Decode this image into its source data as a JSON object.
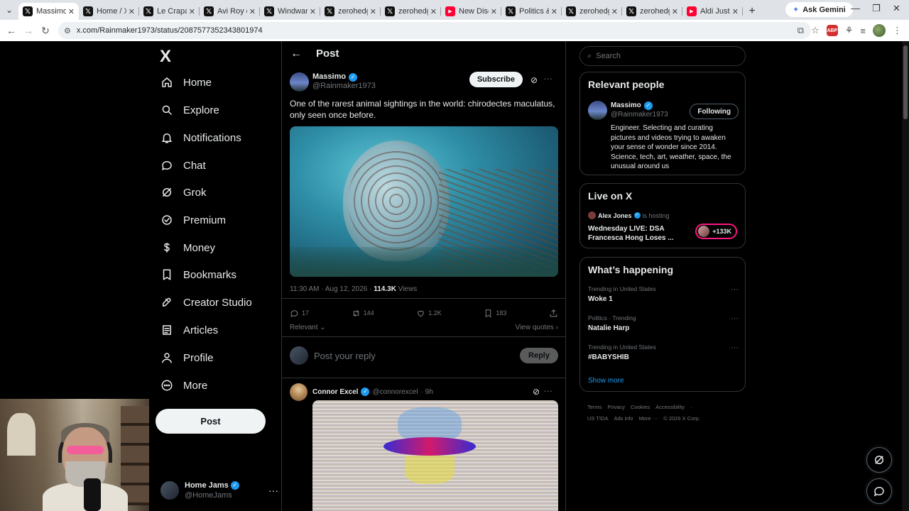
{
  "browser": {
    "tabs": [
      {
        "label": "Massimo on X",
        "favicon": "x",
        "active": true
      },
      {
        "label": "Home / X",
        "favicon": "x"
      },
      {
        "label": "Le Crapaud",
        "favicon": "x"
      },
      {
        "label": "Avi Roy on X",
        "favicon": "x"
      },
      {
        "label": "Windward",
        "favicon": "x"
      },
      {
        "label": "zerohedge",
        "favicon": "x"
      },
      {
        "label": "zerohedge",
        "favicon": "x"
      },
      {
        "label": "New Disco",
        "favicon": "yt"
      },
      {
        "label": "Politics &",
        "favicon": "x"
      },
      {
        "label": "zerohedge",
        "favicon": "x"
      },
      {
        "label": "zerohedge",
        "favicon": "x"
      },
      {
        "label": "Aldi Just D",
        "favicon": "yt"
      }
    ],
    "ask_gemini": "Ask Gemini",
    "url": "x.com/Rainmaker1973/status/2087577352343801974"
  },
  "nav": {
    "logo": "X",
    "items": [
      {
        "label": "Home",
        "icon": "home-icon"
      },
      {
        "label": "Explore",
        "icon": "search-icon"
      },
      {
        "label": "Notifications",
        "icon": "bell-icon"
      },
      {
        "label": "Chat",
        "icon": "chat-icon"
      },
      {
        "label": "Grok",
        "icon": "grok-icon"
      },
      {
        "label": "Premium",
        "icon": "premium-icon"
      },
      {
        "label": "Money",
        "icon": "money-icon"
      },
      {
        "label": "Bookmarks",
        "icon": "bookmark-icon"
      },
      {
        "label": "Creator Studio",
        "icon": "rocket-icon"
      },
      {
        "label": "Articles",
        "icon": "article-icon"
      },
      {
        "label": "Profile",
        "icon": "person-icon"
      },
      {
        "label": "More",
        "icon": "more-circle-icon"
      }
    ],
    "post_button": "Post",
    "account": {
      "name": "Home Jams",
      "handle": "@HomeJams"
    }
  },
  "post_page": {
    "title": "Post",
    "author": {
      "name": "Massimo",
      "handle": "@Rainmaker1973"
    },
    "subscribe": "Subscribe",
    "text": "One of the rarest animal sightings in the world: chirodectes maculatus, only seen once before.",
    "time": "11:30 AM · Aug 12, 2026 ·",
    "views_count": "114.3K",
    "views_label": "Views",
    "stats": {
      "replies": "17",
      "reposts": "144",
      "likes": "1.2K",
      "bookmarks": "183"
    },
    "sort_label": "Relevant",
    "view_quotes": "View quotes",
    "reply_placeholder": "Post your reply",
    "reply_button": "Reply",
    "first_reply": {
      "name": "Connor Excel",
      "handle": "@connorexcel",
      "time": "· 9h"
    }
  },
  "sidebar": {
    "search_placeholder": "Search",
    "relevant_people": {
      "title": "Relevant people",
      "name": "Massimo",
      "handle": "@Rainmaker1973",
      "button": "Following",
      "bio": "Engineer. Selecting and curating pictures and videos trying to awaken your sense of wonder since 2014. Science, tech, art, weather, space, the unusual around us"
    },
    "live": {
      "title": "Live on X",
      "host": "Alex Jones",
      "hosting": "is hosting",
      "event": "Wednesday LIVE: DSA Francesca Hong Loses ...",
      "count": "+133K"
    },
    "happening": {
      "title": "What’s happening",
      "trends": [
        {
          "category": "Trending in United States",
          "name": "Woke 1"
        },
        {
          "category": "Politics · Trending",
          "name": "Natalie Harp"
        },
        {
          "category": "Trending in United States",
          "name": "#BABYSHIB"
        }
      ],
      "show_more": "Show more"
    },
    "footer": {
      "line1": [
        "Terms",
        "Privacy",
        "Cookies",
        "Accessibility",
        "·"
      ],
      "line2": [
        "US TIDA",
        "Ads info",
        "More ···",
        "© 2026 X Corp."
      ]
    }
  },
  "colors": {
    "accent": "#1d9bf0",
    "live_ring": "#f91880",
    "background": "#000000"
  }
}
